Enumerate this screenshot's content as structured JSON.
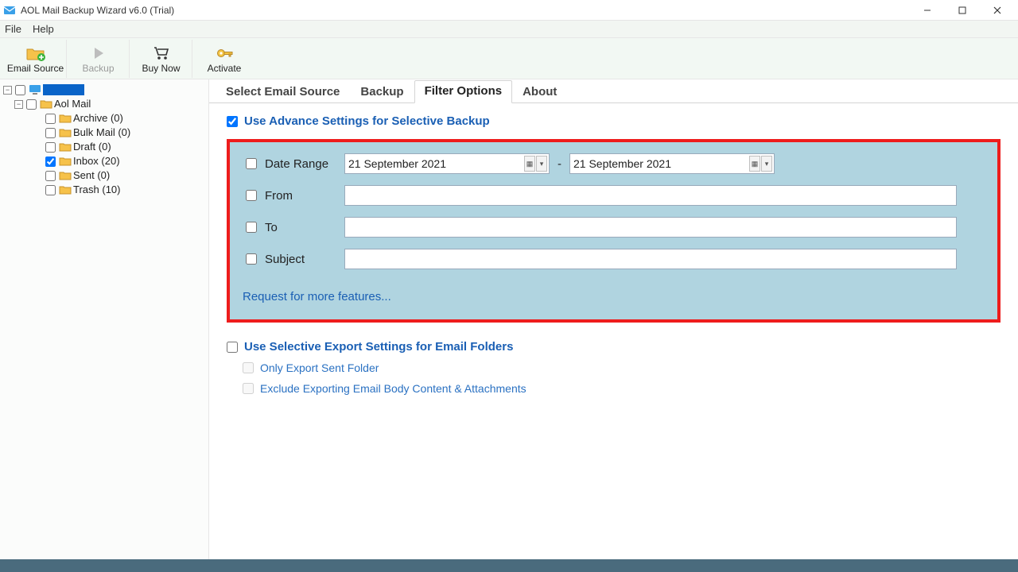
{
  "window": {
    "title": "AOL Mail Backup Wizard v6.0 (Trial)"
  },
  "menubar": {
    "file": "File",
    "help": "Help"
  },
  "toolbar": {
    "email_source": "Email Source",
    "backup": "Backup",
    "buy_now": "Buy Now",
    "activate": "Activate"
  },
  "tree": {
    "root_selected_text": "",
    "aol_mail": "Aol Mail",
    "folders": {
      "archive": "Archive (0)",
      "bulk": "Bulk Mail (0)",
      "draft": "Draft (0)",
      "inbox": "Inbox (20)",
      "sent": "Sent (0)",
      "trash": "Trash (10)"
    }
  },
  "tabs": {
    "select_email_source": "Select Email Source",
    "backup": "Backup",
    "filter_options": "Filter Options",
    "about": "About"
  },
  "filter": {
    "advance_label": "Use Advance Settings for Selective Backup",
    "date_range_label": "Date Range",
    "date_from": "21 September 2021",
    "date_to": "21 September 2021",
    "date_dash": "-",
    "from_label": "From",
    "to_label": "To",
    "subject_label": "Subject",
    "request_link": "Request for more features...",
    "selective_export_label": "Use Selective Export Settings for Email Folders",
    "only_sent_label": "Only Export Sent Folder",
    "exclude_body_label": "Exclude Exporting Email Body Content & Attachments"
  }
}
